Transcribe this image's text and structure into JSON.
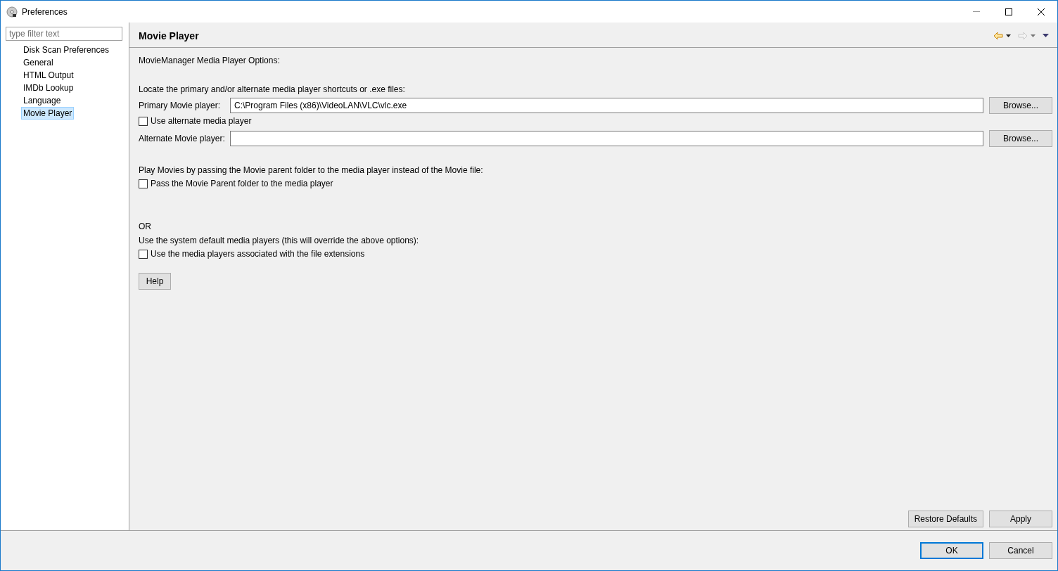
{
  "window": {
    "title": "Preferences"
  },
  "sidebar": {
    "filter": {
      "placeholder": "type filter text"
    },
    "items": [
      {
        "label": "Disk Scan Preferences",
        "selected": false
      },
      {
        "label": "General",
        "selected": false
      },
      {
        "label": "HTML Output",
        "selected": false
      },
      {
        "label": "IMDb Lookup",
        "selected": false
      },
      {
        "label": "Language",
        "selected": false
      },
      {
        "label": "Movie Player",
        "selected": true
      }
    ]
  },
  "page": {
    "title": "Movie Player",
    "intro": "MovieManager Media Player Options:",
    "locate_label": "Locate the primary and/or alternate media player shortcuts or .exe files:",
    "primary": {
      "label": "Primary Movie player:",
      "value": "C:\\Program Files (x86)\\VideoLAN\\VLC\\vlc.exe",
      "button": "Browse..."
    },
    "use_alternate": {
      "label": "Use alternate media player",
      "checked": false
    },
    "alternate": {
      "label": "Alternate Movie player:",
      "button": "Browse..."
    },
    "parent_label": "Play Movies by passing the Movie parent folder to the media player instead of the Movie file:",
    "pass_parent": {
      "label": "Pass the Movie Parent folder to the media player",
      "checked": false
    },
    "or_label": "OR",
    "system_label": "Use the system default media players (this will override the above options):",
    "use_system": {
      "label": "Use the media players associated with the file extensions",
      "checked": false
    },
    "help_button": "Help",
    "restore_button": "Restore Defaults",
    "apply_button": "Apply"
  },
  "buttons": [
    {
      "label": "OK",
      "default": true
    },
    {
      "label": "Cancel",
      "default": false
    }
  ]
}
